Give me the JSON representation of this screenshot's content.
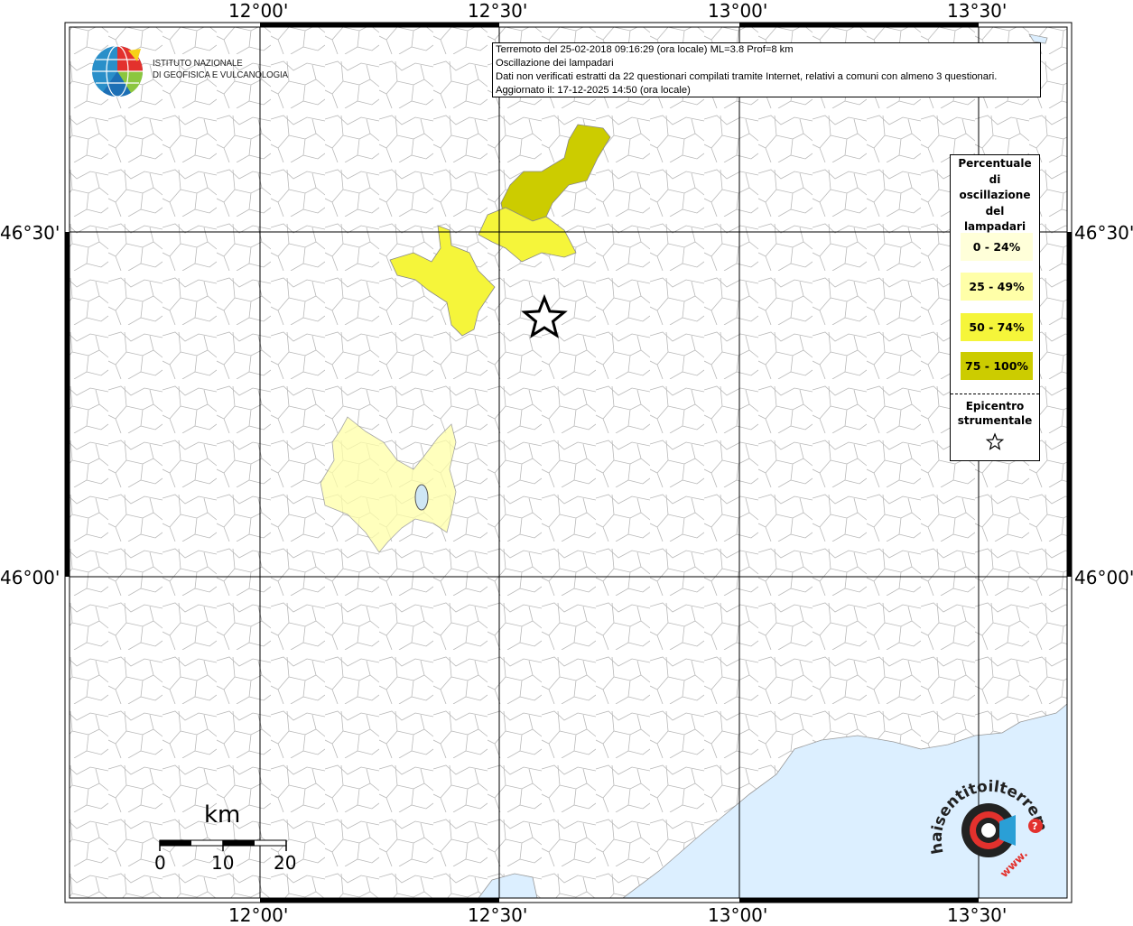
{
  "info": {
    "line1": "Terremoto del 25-02-2018 09:16:29 (ora locale) ML=3.8 Prof=8 km",
    "line2": "Oscillazione dei lampadari",
    "line3": "Dati non verificati estratti da 22 questionari compilati tramite Internet, relativi a comuni con almeno 3 questionari.",
    "line4": "Aggiornato il: 17-12-2025 14:50 (ora locale)"
  },
  "axes": {
    "lon_top": [
      "12°00'",
      "12°30'",
      "13°00'",
      "13°30'"
    ],
    "lon_bottom": [
      "12°00'",
      "12°30'",
      "13°00'",
      "13°30'"
    ],
    "lat_left": [
      "46°30'",
      "46°00'"
    ],
    "lat_right": [
      "46°30'",
      "46°00'"
    ]
  },
  "legend": {
    "title_lines": [
      "Percentuale",
      "di",
      "oscillazione",
      "del",
      "lampadari"
    ],
    "classes": [
      {
        "label": "0 - 24%",
        "color": "#ffffd9"
      },
      {
        "label": "25 - 49%",
        "color": "#ffffa8"
      },
      {
        "label": "50 - 74%",
        "color": "#f5f53a"
      },
      {
        "label": "75 - 100%",
        "color": "#cccc00"
      }
    ],
    "epicenter_lines": [
      "Epicentro",
      "strumentale"
    ]
  },
  "logo": {
    "line1": "ISTITUTO NAZIONALE",
    "line2": "DI GEOFISICA E VULCANOLOGIA"
  },
  "scale": {
    "unit": "km",
    "ticks": [
      "0",
      "10",
      "20"
    ]
  },
  "watermark": {
    "text": "haisentitoilterremoto.it",
    "url_text": "www."
  },
  "colors": {
    "sea": "#dcefff",
    "border": "#b0b0b0",
    "grid": "#000000"
  }
}
